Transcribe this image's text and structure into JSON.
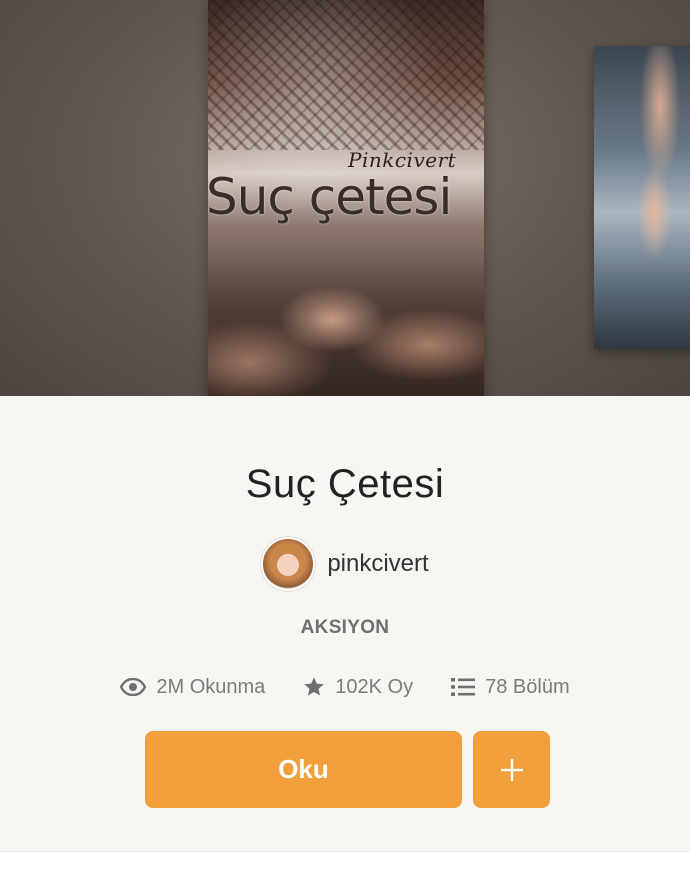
{
  "cover": {
    "author_signature": "Pinkcivert",
    "cover_title": "Suç çetesi"
  },
  "book": {
    "title": "Suç Çetesi",
    "author": "pinkcivert",
    "genre": "AKSIYON"
  },
  "stats": {
    "reads": "2M Okunma",
    "votes": "102K Oy",
    "parts": "78 Bölüm"
  },
  "actions": {
    "read_label": "Oku",
    "add_label": "+"
  },
  "colors": {
    "accent": "#f2a03b",
    "background": "#f7f6f3"
  },
  "icons": [
    "eye-icon",
    "star-icon",
    "list-icon",
    "plus-icon"
  ]
}
